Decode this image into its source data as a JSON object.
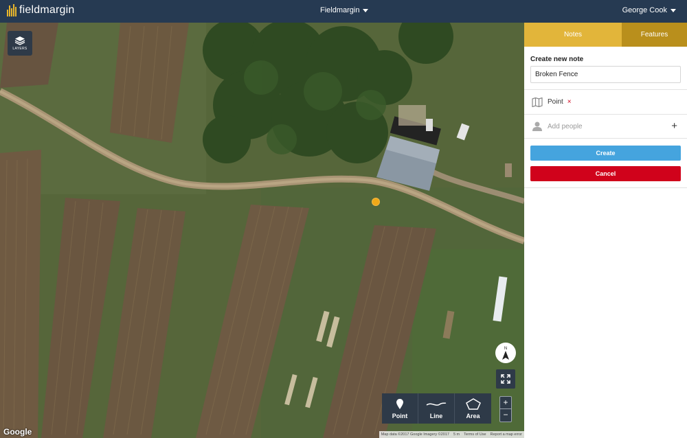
{
  "app": {
    "logo_text": "fieldmargin",
    "farm_selector": "Fieldmargin",
    "user_name": "George Cook"
  },
  "map": {
    "layers_label": "LAYERS",
    "compass_label": "N",
    "draw_tools": [
      {
        "label": "Point",
        "icon": "point-pin-icon"
      },
      {
        "label": "Line",
        "icon": "line-icon"
      },
      {
        "label": "Area",
        "icon": "polygon-icon"
      }
    ],
    "zoom_in": "+",
    "zoom_out": "−",
    "google_label": "Google",
    "attribution": {
      "map_data": "Map data ©2017 Google Imagery ©2017",
      "scale": "5 m",
      "terms": "Terms of Use",
      "report": "Report a map error"
    }
  },
  "sidebar": {
    "tabs": [
      {
        "label": "Notes",
        "active": true
      },
      {
        "label": "Features",
        "active": false
      }
    ],
    "title": "Create new note",
    "note_value": "Broken Fence",
    "location_label": "Point",
    "remove_label": "×",
    "people_placeholder": "Add people",
    "add_label": "+",
    "create_label": "Create",
    "cancel_label": "Cancel"
  },
  "colors": {
    "topbar": "#263a52",
    "accent_gold": "#e2b53a",
    "accent_gold_dark": "#b98f1c",
    "create_blue": "#45a4de",
    "cancel_red": "#d0021b",
    "pin_orange": "#f0a818"
  }
}
